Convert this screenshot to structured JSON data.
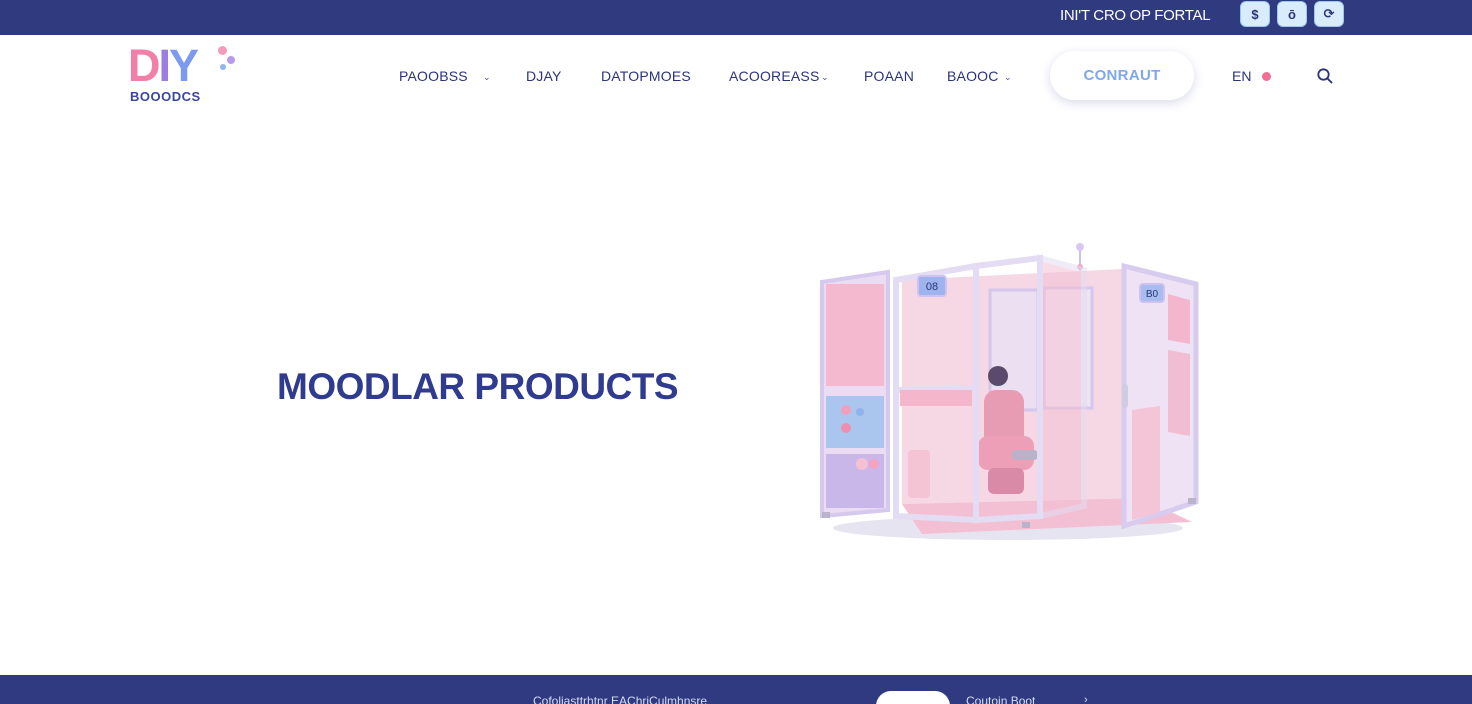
{
  "topbar": {
    "link_label": "INI'T CRO OP FORTAL",
    "social_icons": [
      {
        "icon": "dollar-icon",
        "glyph": "$"
      },
      {
        "icon": "instagram-icon",
        "glyph": "ō"
      },
      {
        "icon": "chat-icon",
        "glyph": "⟳"
      }
    ]
  },
  "header": {
    "logo_mark": [
      "D",
      "I",
      "Y"
    ],
    "logo_word": "BOOODCS",
    "nav": [
      {
        "label": "PAOOBSS",
        "dropdown": true
      },
      {
        "label": "DJAY",
        "dropdown": false
      },
      {
        "label": "DATOPMOES",
        "dropdown": false
      },
      {
        "label": "ACOOREASS",
        "dropdown": true
      },
      {
        "label": "POAAN",
        "dropdown": false
      },
      {
        "label": "BAOOC",
        "dropdown": true
      }
    ],
    "contact_label": "CONRAUT",
    "lang_label": "EN"
  },
  "hero": {
    "title": "MOODLAR PRODUCTS",
    "booth_display_left": "08",
    "booth_display_right": "B0"
  },
  "footer": {
    "text": "Cofoliasttrhtnr EAChriCulmhnsre",
    "text2": "Coutoin Boot",
    "arrow": "›"
  },
  "colors": {
    "navy": "#303a7e",
    "pink": "#f17fa8",
    "lavender": "#b7a8e8",
    "sky": "#9cc6ee"
  }
}
